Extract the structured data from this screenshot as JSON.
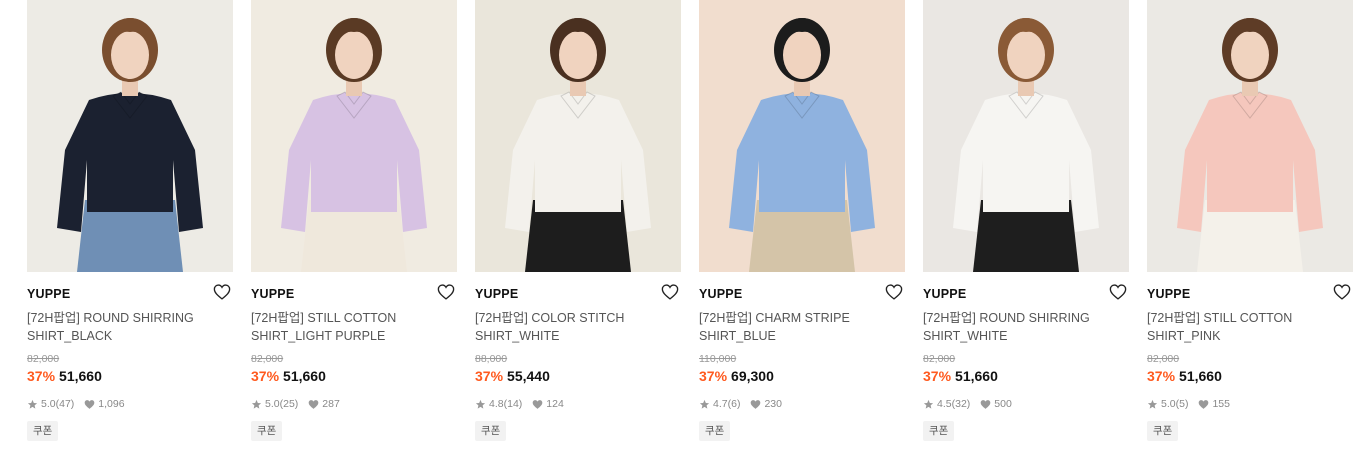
{
  "products": [
    {
      "brand": "YUPPE",
      "name_line1": "[72H팝업] ROUND SHIRRING",
      "name_line2": "SHIRT_BLACK",
      "original_price": "82,000",
      "discount": "37%",
      "price": "51,660",
      "rating": "5.0",
      "reviews": "(47)",
      "likes": "1,096",
      "coupon": "쿠폰",
      "image": {
        "bg": "#e9e6e1",
        "wall": "#f2efea",
        "hair": "#7a4e2f",
        "top": "#1b2130",
        "bottom": "#6f8fb5"
      }
    },
    {
      "brand": "YUPPE",
      "name_line1": "[72H팝업] STILL COTTON",
      "name_line2": "SHIRT_LIGHT PURPLE",
      "original_price": "82,000",
      "discount": "37%",
      "price": "51,660",
      "rating": "5.0",
      "reviews": "(25)",
      "likes": "287",
      "coupon": "쿠폰",
      "image": {
        "bg": "#ede7dc",
        "wall": "#f4efe6",
        "hair": "#5a3a24",
        "top": "#d7c2e3",
        "bottom": "#efe8dc"
      }
    },
    {
      "brand": "YUPPE",
      "name_line1": "[72H팝업] COLOR STITCH",
      "name_line2": "SHIRT_WHITE",
      "original_price": "88,000",
      "discount": "37%",
      "price": "55,440",
      "rating": "4.8",
      "reviews": "(14)",
      "likes": "124",
      "coupon": "쿠폰",
      "image": {
        "bg": "#e6e2d6",
        "wall": "#eeeadf",
        "hair": "#4a3020",
        "top": "#f3f1ec",
        "bottom": "#1d1d1d"
      }
    },
    {
      "brand": "YUPPE",
      "name_line1": "[72H팝업] CHARM STRIPE",
      "name_line2": "SHIRT_BLUE",
      "original_price": "110,000",
      "discount": "37%",
      "price": "69,300",
      "rating": "4.7",
      "reviews": "(6)",
      "likes": "230",
      "coupon": "쿠폰",
      "image": {
        "bg": "#eed9c8",
        "wall": "#f3e2d4",
        "hair": "#1c1c1c",
        "top": "#8fb2df",
        "bottom": "#d4c4a8"
      }
    },
    {
      "brand": "YUPPE",
      "name_line1": "[72H팝업] ROUND SHIRRING",
      "name_line2": "SHIRT_WHITE",
      "original_price": "82,000",
      "discount": "37%",
      "price": "51,660",
      "rating": "4.5",
      "reviews": "(32)",
      "likes": "500",
      "coupon": "쿠폰",
      "image": {
        "bg": "#e6e3df",
        "wall": "#eeebe7",
        "hair": "#8a5a36",
        "top": "#f6f5f2",
        "bottom": "#1e1e1e"
      }
    },
    {
      "brand": "YUPPE",
      "name_line1": "[72H팝업] STILL COTTON",
      "name_line2": "SHIRT_PINK",
      "original_price": "82,000",
      "discount": "37%",
      "price": "51,660",
      "rating": "5.0",
      "reviews": "(5)",
      "likes": "155",
      "coupon": "쿠폰",
      "image": {
        "bg": "#e7e4df",
        "wall": "#efede9",
        "hair": "#5e3c26",
        "top": "#f5c7bd",
        "bottom": "#f4f1ea"
      }
    }
  ],
  "colors": {
    "discount": "#ff5a1f",
    "muted": "#888888",
    "coupon_bg": "#f2f2f2"
  },
  "icons": {
    "wishlist": "heart-outline-icon",
    "rating": "star-icon",
    "likes": "heart-filled-icon"
  }
}
